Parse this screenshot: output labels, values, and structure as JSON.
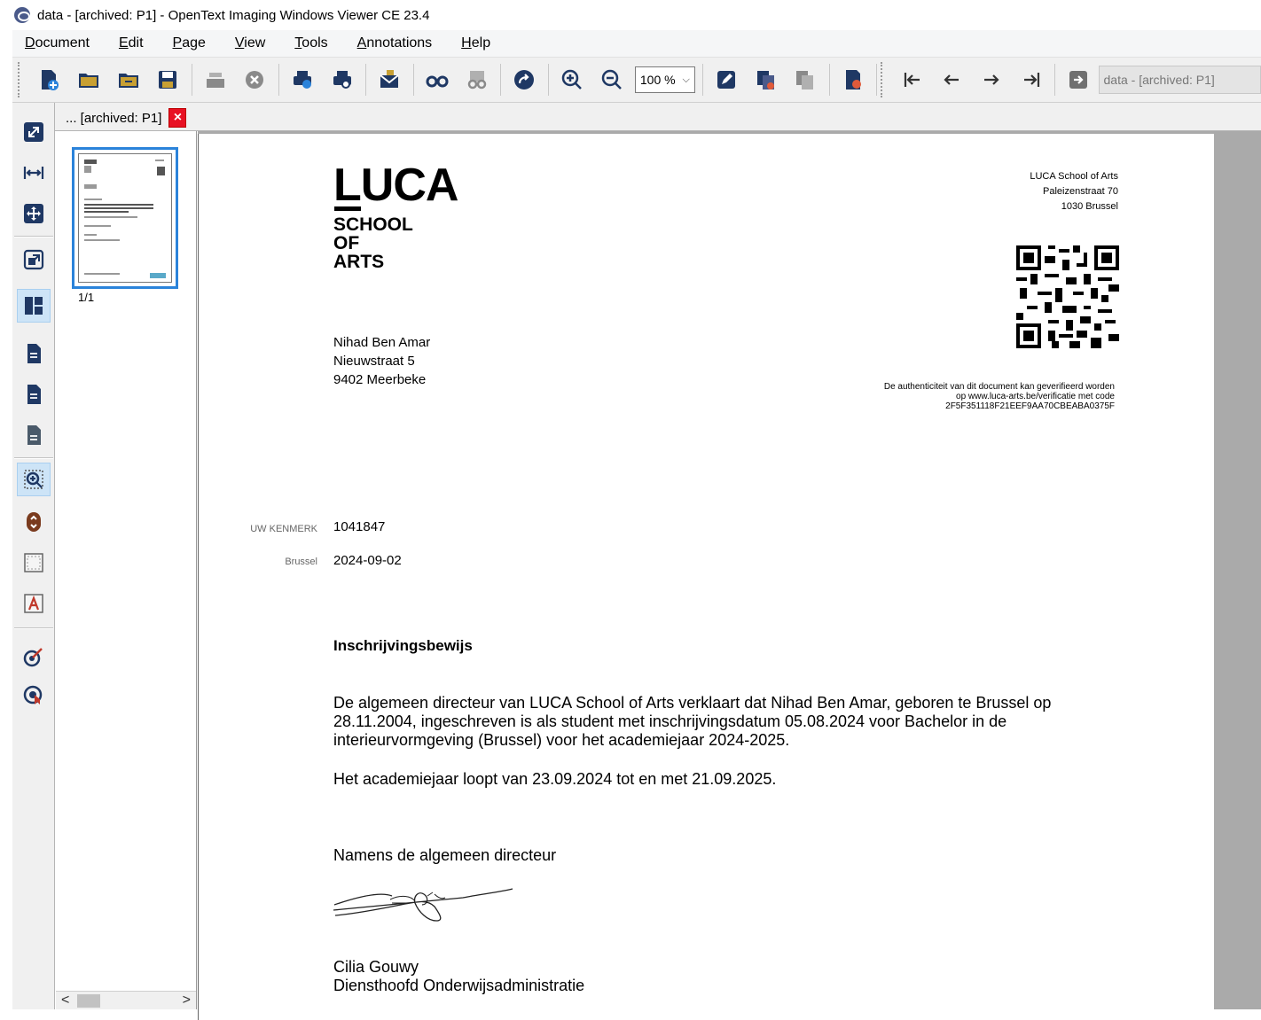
{
  "window": {
    "title": "data - [archived: P1] - OpenText Imaging Windows Viewer CE 23.4"
  },
  "menu": {
    "items": [
      {
        "label": "Document",
        "accel": "D",
        "rest": "ocument"
      },
      {
        "label": "Edit",
        "accel": "E",
        "rest": "dit"
      },
      {
        "label": "Page",
        "accel": "P",
        "rest": "age"
      },
      {
        "label": "View",
        "accel": "V",
        "rest": "iew"
      },
      {
        "label": "Tools",
        "accel": "T",
        "rest": "ools"
      },
      {
        "label": "Annotations",
        "accel": "A",
        "rest": "nnotations"
      },
      {
        "label": "Help",
        "accel": "H",
        "rest": "elp"
      }
    ]
  },
  "toolbar": {
    "zoom_value": "100 %",
    "document_field": "data - [archived: P1]"
  },
  "tab": {
    "label": "... [archived: P1]",
    "close": "×"
  },
  "thumbnails": {
    "page_label": "1/1",
    "scroll_left": "<",
    "scroll_right": ">"
  },
  "document": {
    "logo_main": "LUCA",
    "logo_sub": [
      "SCHOOL",
      "OF",
      "ARTS"
    ],
    "school_address": [
      "LUCA School of Arts",
      "Paleizenstraat 70",
      "1030 Brussel"
    ],
    "authenticity": [
      "De authenticiteit van dit document kan geverifieerd worden",
      "op www.luca-arts.be/verificatie met code",
      "2F5F351118F21EEF9AA70CBEABA0375F"
    ],
    "recipient": [
      "Nihad Ben Amar",
      "Nieuwstraat 5",
      "9402 Meerbeke"
    ],
    "reference_label": "UW KENMERK",
    "reference_value": "1041847",
    "place_label": "Brussel",
    "date_value": "2024-09-02",
    "heading": "Inschrijvingsbewijs",
    "paragraph1": "De algemeen directeur van LUCA School of Arts verklaart dat Nihad Ben Amar, geboren te Brussel op 28.11.2004, ingeschreven is als student met inschrijvingsdatum 05.08.2024  voor Bachelor in de interieurvormgeving (Brussel) voor het academiejaar 2024-2025.",
    "paragraph2": "Het academiejaar loopt van 23.09.2024 tot en met 21.09.2025.",
    "closing": "Namens de algemeen directeur",
    "signer_name": "Cilia Gouwy",
    "signer_title": "Diensthoofd Onderwijsadministratie"
  },
  "colors": {
    "accent_blue": "#2b83da",
    "close_red": "#e81123",
    "icon_navy": "#1f3864",
    "icon_gold": "#c8a033"
  }
}
